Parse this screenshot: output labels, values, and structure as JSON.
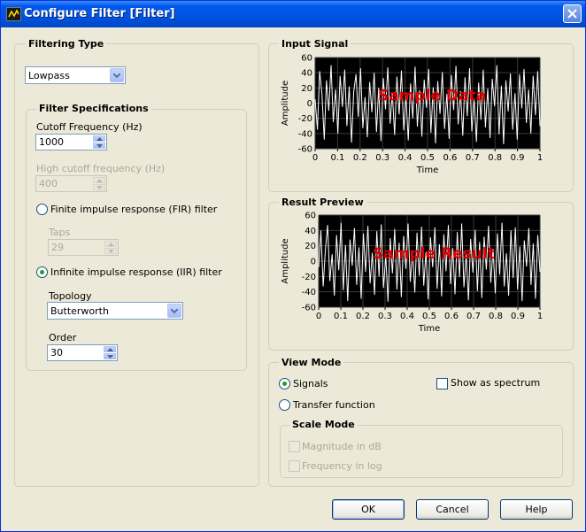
{
  "window": {
    "title": "Configure Filter [Filter]"
  },
  "filtering_type": {
    "title": "Filtering Type",
    "selected": "Lowpass"
  },
  "filter_specs": {
    "title": "Filter Specifications",
    "cutoff_label": "Cutoff Frequency (Hz)",
    "cutoff_value": "1000",
    "high_cutoff_label": "High cutoff frequency (Hz)",
    "high_cutoff_value": "400",
    "fir_label": "Finite impulse response (FIR) filter",
    "fir_selected": false,
    "taps_label": "Taps",
    "taps_value": "29",
    "iir_label": "Infinite impulse response (IIR) filter",
    "iir_selected": true,
    "topology_label": "Topology",
    "topology_value": "Butterworth",
    "order_label": "Order",
    "order_value": "30"
  },
  "input_signal": {
    "title": "Input Signal"
  },
  "result_preview": {
    "title": "Result Preview"
  },
  "view_mode": {
    "title": "View Mode",
    "signals_label": "Signals",
    "signals_selected": true,
    "transfer_label": "Transfer function",
    "transfer_selected": false,
    "spectrum_label": "Show as spectrum",
    "spectrum_checked": false,
    "scale_mode_title": "Scale Mode",
    "magnitude_label": "Magnitude in dB",
    "frequency_label": "Frequency in log"
  },
  "buttons": {
    "ok": "OK",
    "cancel": "Cancel",
    "help": "Help"
  },
  "colors": {
    "plot_background": "#000000",
    "trace": "#ffffff",
    "watermark": "#e00000",
    "title_bar": "#0054e3"
  },
  "chart_data": [
    {
      "type": "line",
      "title": "Input Signal",
      "watermark": "Sample Data",
      "xlabel": "Time",
      "ylabel": "Amplitude",
      "xlim": [
        0,
        1
      ],
      "ylim": [
        -60,
        60
      ],
      "xticks": [
        "0",
        "0.1",
        "0.2",
        "0.3",
        "0.4",
        "0.5",
        "0.6",
        "0.7",
        "0.8",
        "0.9",
        "1"
      ],
      "yticks": [
        "60",
        "40",
        "20",
        "0",
        "-20",
        "-40",
        "-60"
      ],
      "grid": true,
      "series": [
        {
          "description_values_range": [
            -55,
            55
          ],
          "values": [
            5,
            -35,
            42,
            12,
            -48,
            30,
            -10,
            50,
            -25,
            18,
            -40,
            36,
            -5,
            44,
            -30,
            22,
            -52,
            15,
            38,
            -18,
            46,
            -33,
            8,
            -45,
            28,
            -12,
            40,
            -38,
            20,
            -50,
            33,
            -8,
            47,
            -27,
            14,
            -42,
            35,
            -15,
            43,
            -36,
            10,
            -49,
            26,
            -20,
            48,
            -31,
            17,
            -44,
            31,
            -6,
            45,
            -39,
            21,
            -53,
            29,
            -14,
            41,
            -34,
            12,
            -47,
            37,
            -9,
            49,
            -28,
            16,
            -43,
            34,
            -17,
            46,
            -37,
            6,
            -51,
            27,
            -22,
            44,
            -32,
            19,
            -46,
            32,
            -4,
            50,
            -41,
            23,
            -54,
            30,
            -11,
            39,
            -35,
            13,
            -48,
            38,
            -7,
            45,
            -26,
            18,
            -40,
            36,
            -16,
            42,
            -30
          ]
        }
      ]
    },
    {
      "type": "line",
      "title": "Result Preview",
      "watermark": "Sample Result",
      "xlabel": "Time",
      "ylabel": "Amplitude",
      "xlim": [
        0,
        1
      ],
      "ylim": [
        -60,
        60
      ],
      "xticks": [
        "0",
        "0.1",
        "0.2",
        "0.3",
        "0.4",
        "0.5",
        "0.6",
        "0.7",
        "0.8",
        "0.9",
        "1"
      ],
      "yticks": [
        "60",
        "40",
        "20",
        "0",
        "-20",
        "-40",
        "-60"
      ],
      "grid": true,
      "series": [
        {
          "values": [
            -8,
            40,
            -33,
            15,
            47,
            -26,
            9,
            -45,
            34,
            -12,
            50,
            -38,
            21,
            -52,
            28,
            -6,
            43,
            -31,
            18,
            -49,
            36,
            -14,
            46,
            -29,
            11,
            -44,
            39,
            -20,
            48,
            -35,
            7,
            -53,
            30,
            -16,
            42,
            -37,
            24,
            -47,
            33,
            -10,
            49,
            -27,
            14,
            -41,
            37,
            -19,
            45,
            -32,
            12,
            -50,
            31,
            -8,
            44,
            -36,
            22,
            -46,
            35,
            -13,
            47,
            -30,
            17,
            -43,
            38,
            -21,
            49,
            -34,
            9,
            -51,
            29,
            -15,
            41,
            -39,
            25,
            -48,
            32,
            -11,
            46,
            -28,
            16,
            -42,
            36,
            -18,
            50,
            -33,
            10,
            -45,
            40,
            -22,
            44,
            -37,
            19,
            -52,
            27,
            -7,
            43,
            -31,
            23,
            -49,
            34,
            -14
          ]
        }
      ]
    }
  ]
}
